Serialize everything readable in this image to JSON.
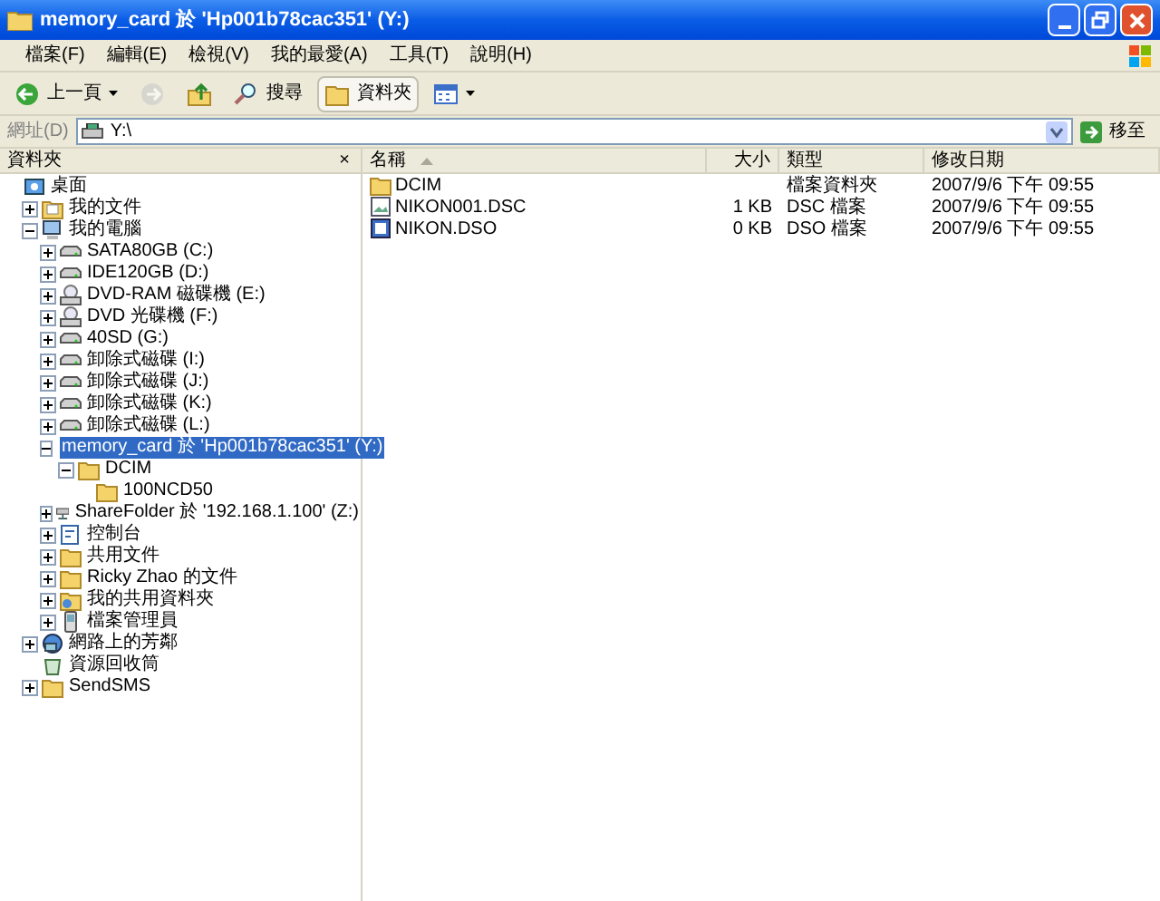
{
  "window": {
    "title": "memory_card 於 'Hp001b78cac351' (Y:)"
  },
  "menu": [
    "檔案(F)",
    "編輯(E)",
    "檢視(V)",
    "我的最愛(A)",
    "工具(T)",
    "說明(H)"
  ],
  "toolbar": [
    {
      "kind": "back",
      "label": "上一頁",
      "disabled": false,
      "selected": false
    },
    {
      "kind": "forward",
      "disabled": true,
      "selected": false
    },
    {
      "kind": "up",
      "disabled": false,
      "selected": false
    },
    {
      "kind": "search",
      "label": "搜尋",
      "disabled": false,
      "selected": false
    },
    {
      "kind": "folders",
      "label": "資料夾",
      "disabled": false,
      "selected": true
    },
    {
      "kind": "views",
      "disabled": false,
      "selected": false
    }
  ],
  "address": {
    "label": "網址(D)",
    "value": "Y:\\",
    "go": "移至"
  },
  "folders_pane": {
    "title": "資料夾",
    "close": "×"
  },
  "tree": [
    {
      "label": "桌面",
      "kind": "desktop",
      "selected": false,
      "children": [
        {
          "label": "我的文件",
          "kind": "docs",
          "expanded": false,
          "selected": false
        },
        {
          "label": "我的電腦",
          "kind": "computer",
          "expanded": true,
          "selected": false,
          "children": [
            {
              "label": "SATA80GB (C:)",
              "kind": "drive",
              "expanded": false,
              "selected": false
            },
            {
              "label": "IDE120GB (D:)",
              "kind": "drive",
              "expanded": false,
              "selected": false
            },
            {
              "label": "DVD-RAM 磁碟機 (E:)",
              "kind": "cdrom",
              "expanded": false,
              "selected": false
            },
            {
              "label": "DVD 光碟機 (F:)",
              "kind": "cdrom",
              "expanded": false,
              "selected": false
            },
            {
              "label": "40SD (G:)",
              "kind": "drive",
              "expanded": false,
              "selected": false
            },
            {
              "label": "卸除式磁碟 (I:)",
              "kind": "drive",
              "expanded": false,
              "selected": false
            },
            {
              "label": "卸除式磁碟 (J:)",
              "kind": "drive",
              "expanded": false,
              "selected": false
            },
            {
              "label": "卸除式磁碟 (K:)",
              "kind": "drive",
              "expanded": false,
              "selected": false
            },
            {
              "label": "卸除式磁碟 (L:)",
              "kind": "drive",
              "expanded": false,
              "selected": false
            },
            {
              "label": "memory_card 於 'Hp001b78cac351' (Y:)",
              "kind": "netdrive",
              "expanded": true,
              "selected": true,
              "children": [
                {
                  "label": "DCIM",
                  "kind": "folder",
                  "expanded": true,
                  "selected": false,
                  "children": [
                    {
                      "label": "100NCD50",
                      "kind": "folder",
                      "selected": false
                    }
                  ]
                }
              ]
            },
            {
              "label": "ShareFolder 於 '192.168.1.100' (Z:)",
              "kind": "netdrive",
              "expanded": false,
              "selected": false
            },
            {
              "label": "控制台",
              "kind": "control",
              "expanded": false,
              "selected": false
            },
            {
              "label": "共用文件",
              "kind": "folder",
              "expanded": false,
              "selected": false
            },
            {
              "label": "Ricky Zhao 的文件",
              "kind": "folder",
              "expanded": false,
              "selected": false
            },
            {
              "label": "我的共用資料夾",
              "kind": "shared",
              "expanded": false,
              "selected": false
            },
            {
              "label": "檔案管理員",
              "kind": "device",
              "expanded": false,
              "selected": false
            }
          ]
        },
        {
          "label": "網路上的芳鄰",
          "kind": "network",
          "expanded": false,
          "selected": false
        },
        {
          "label": "資源回收筒",
          "kind": "recycle",
          "selected": false
        },
        {
          "label": "SendSMS",
          "kind": "folder",
          "expanded": false,
          "selected": false
        }
      ]
    }
  ],
  "list": {
    "columns": [
      {
        "label": "名稱",
        "sorted": true
      },
      {
        "label": "大小",
        "sorted": false
      },
      {
        "label": "類型",
        "sorted": false
      },
      {
        "label": "修改日期",
        "sorted": false
      }
    ],
    "rows": [
      {
        "kind": "folder",
        "cells": [
          "DCIM",
          "",
          "檔案資料夾",
          "2007/9/6 下午 09:55"
        ]
      },
      {
        "kind": "image",
        "cells": [
          "NIKON001.DSC",
          "1 KB",
          "DSC 檔案",
          "2007/9/6 下午 09:55"
        ]
      },
      {
        "kind": "file",
        "cells": [
          "NIKON.DSO",
          "0 KB",
          "DSO 檔案",
          "2007/9/6 下午 09:55"
        ]
      }
    ]
  }
}
